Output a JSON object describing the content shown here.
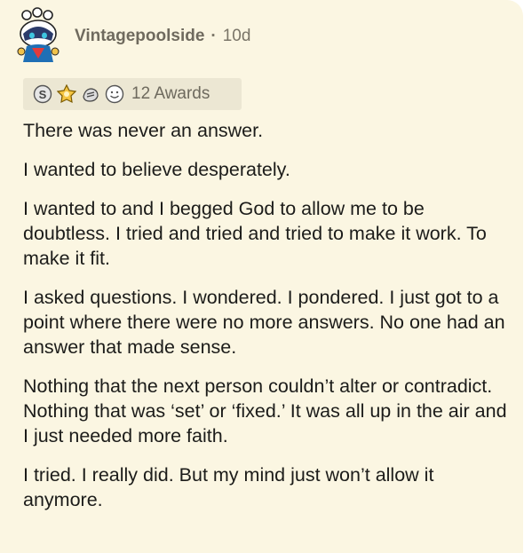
{
  "comment": {
    "username": "Vintagepoolside",
    "separator": "·",
    "age": "10d",
    "awards": {
      "icons": [
        "silver-award-icon",
        "gold-award-icon",
        "helpful-award-icon",
        "wholesome-award-icon"
      ],
      "count_label": "12 Awards"
    },
    "paragraphs": [
      "There was never an answer.",
      "I wanted to believe desperately.",
      "I wanted to and I begged God to allow me to be doubtless. I tried and tried and tried to make it work. To make it fit.",
      "I asked questions. I wondered. I pondered. I just got to a point where there were no more answers. No one had an answer that made sense.",
      "Nothing that the next person couldn’t alter or contradict. Nothing that was ‘set’ or ‘fixed.’ It was all up in the air and I just needed more faith.",
      "I tried. I really did. But my mind just won’t allow it anymore."
    ]
  },
  "colors": {
    "card_background": "#fbf6e2",
    "awards_background": "#ece7d3",
    "text": "#1c1c1a",
    "meta_text": "#7a7568"
  }
}
